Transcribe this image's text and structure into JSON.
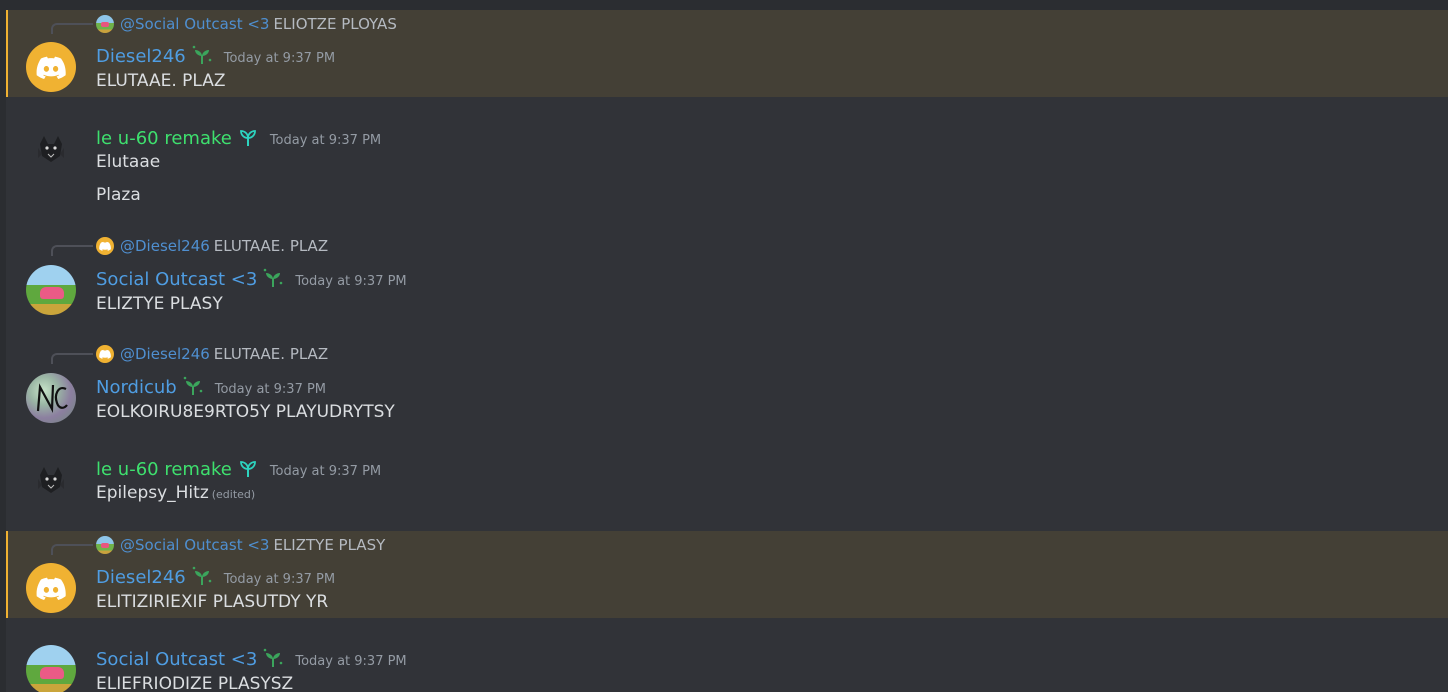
{
  "messages": [
    {
      "reply": {
        "author": "@Social Outcast <3",
        "text": "ELIOTZE PLOYAS",
        "avatar": "landscape"
      },
      "author": "Diesel246",
      "badge": "sprout-icon",
      "timestamp": "Today at 9:37 PM",
      "lines": [
        "ELUTAAE. PLAZ"
      ],
      "highlighted": true
    },
    {
      "author": "le u-60 remake",
      "badge": "sprout-cyan-icon",
      "timestamp": "Today at 9:37 PM",
      "lines": [
        "Elutaae",
        "Plaza"
      ]
    },
    {
      "reply": {
        "author": "@Diesel246",
        "text": "ELUTAAE. PLAZ",
        "avatar": "discord"
      },
      "author": "Social Outcast <3",
      "badge": "sprout-icon",
      "timestamp": "Today at 9:37 PM",
      "lines": [
        "ELIZTYE PLASY"
      ]
    },
    {
      "reply": {
        "author": "@Diesel246",
        "text": "ELUTAAE. PLAZ",
        "avatar": "discord"
      },
      "author": "Nordicub",
      "badge": "sprout-icon",
      "timestamp": "Today at 9:37 PM",
      "lines": [
        "EOLKOIRU8E9RTO5Y PLAYUDRYTSY"
      ]
    },
    {
      "author": "le u-60 remake",
      "badge": "sprout-cyan-icon",
      "timestamp": "Today at 9:37 PM",
      "lines": [
        "Epilepsy_Hitz"
      ],
      "edited": "(edited)"
    },
    {
      "reply": {
        "author": "@Social Outcast <3",
        "text": "ELIZTYE PLASY",
        "avatar": "landscape"
      },
      "author": "Diesel246",
      "badge": "sprout-icon",
      "timestamp": "Today at 9:37 PM",
      "lines": [
        "ELITIZIRIEXIF PLASUTDY YR"
      ],
      "highlighted": true
    },
    {
      "author": "Social Outcast <3",
      "badge": "sprout-icon",
      "timestamp": "Today at 9:37 PM",
      "lines": [
        "ELIEFRIODIZE PLASYSZ"
      ]
    }
  ],
  "colors": {
    "background": "#313338",
    "highlight": "#444036",
    "highlight_bar": "#f0b132",
    "username_blue": "#4f9de2",
    "username_green": "#3ee06e",
    "timestamp": "#949ba4"
  }
}
